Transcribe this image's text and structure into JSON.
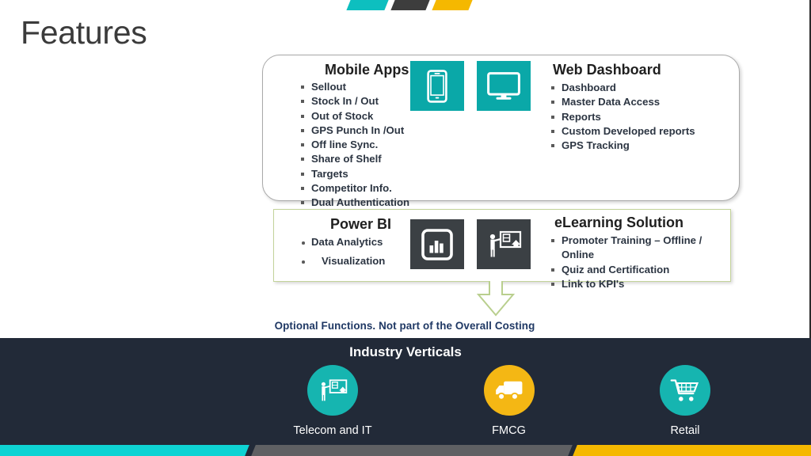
{
  "title": "Features",
  "decor": {
    "top_bars": [
      "teal",
      "dark",
      "yellow"
    ],
    "accent_teal": "#0dbfbf",
    "accent_dark": "#3d3d3d",
    "accent_yellow": "#f5b800"
  },
  "card_top": {
    "mobile": {
      "heading": "Mobile Apps",
      "items": [
        "Sellout",
        "Stock In / Out",
        "Out of Stock",
        "GPS Punch In /Out",
        "Off line Sync.",
        "Share of Shelf",
        "Targets",
        "Competitor Info.",
        "Dual Authentication"
      ]
    },
    "web": {
      "heading": "Web Dashboard",
      "items": [
        "Dashboard",
        "Master Data Access",
        "Reports",
        "Custom Developed reports",
        "GPS Tracking"
      ]
    },
    "icons": [
      "mobile-phone-icon",
      "desktop-monitor-icon"
    ]
  },
  "card_bottom": {
    "powerbi": {
      "heading": "Power BI",
      "items": [
        "Data Analytics",
        "Visualization"
      ]
    },
    "elearning": {
      "heading": "eLearning Solution",
      "items": [
        "Promoter Training – Offline / Online",
        "Quiz and Certification",
        "Link to KPI's"
      ]
    },
    "icons": [
      "bar-chart-icon",
      "training-presentation-icon"
    ]
  },
  "optional_note": "Optional Functions. Not part of the Overall Costing",
  "industry": {
    "title": "Industry Verticals",
    "items": [
      {
        "label": "Telecom and IT",
        "icon": "training-presentation-icon",
        "color": "#16b5b0"
      },
      {
        "label": "FMCG",
        "icon": "delivery-truck-icon",
        "color": "#f4b714"
      },
      {
        "label": "Retail",
        "icon": "shopping-cart-icon",
        "color": "#16b5b0"
      }
    ]
  },
  "ribbon": {
    "segments": [
      "teal",
      "gray",
      "yellow"
    ]
  }
}
